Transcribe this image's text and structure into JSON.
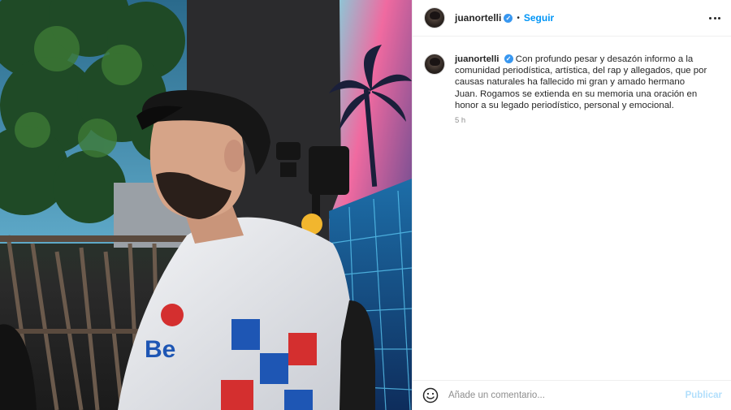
{
  "post": {
    "username": "juanortelli",
    "follow_label": "Seguir",
    "separator": "•",
    "verified_glyph": "✓"
  },
  "caption": {
    "username": "juanortelli",
    "text": "Con profundo pesar y desazón informo a la comunidad periodística, artística, del rap y allegados, que por causas naturales ha fallecido mi gran y amado hermano Juan. Rogamos se extienda en su memoria una oración en honor a su legado periodístico, personal y emocional.",
    "time": "5 h"
  },
  "comment": {
    "placeholder": "Añade un comentario...",
    "publish_label": "Publicar"
  },
  "icons": {
    "more": "more-options-icon",
    "emoji": "emoji-icon",
    "verified": "verified-badge-icon"
  },
  "colors": {
    "link_blue": "#0095f6",
    "publish_disabled": "#b2dffc",
    "verified_blue": "#3897f0",
    "muted_text": "#8e8e8e"
  }
}
